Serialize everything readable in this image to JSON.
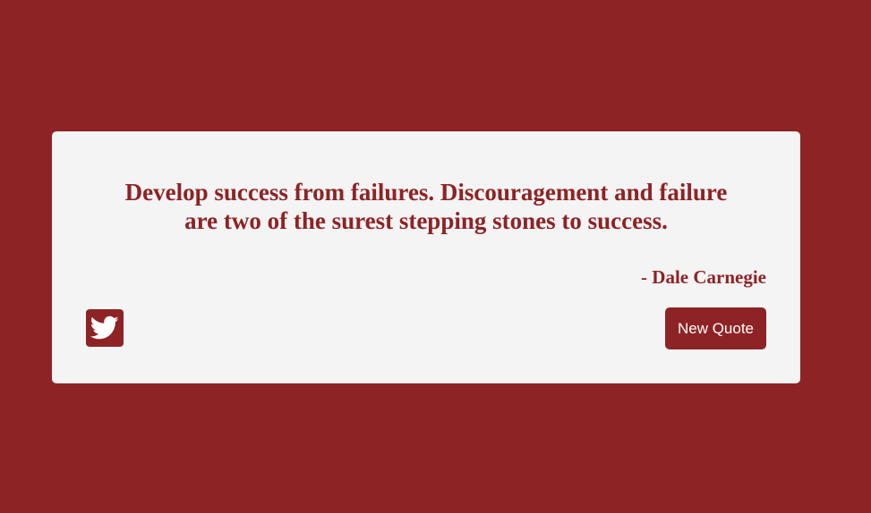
{
  "colors": {
    "background": "#8e2325",
    "card": "#f4f4f4",
    "accent": "#8e2325",
    "button_text": "#ffffff"
  },
  "quote": {
    "text": "Develop success from failures. Discouragement and failure are two of the surest stepping stones to success.",
    "author": "- Dale Carnegie"
  },
  "actions": {
    "tweet_icon": "twitter-icon",
    "new_quote_label": "New Quote"
  }
}
